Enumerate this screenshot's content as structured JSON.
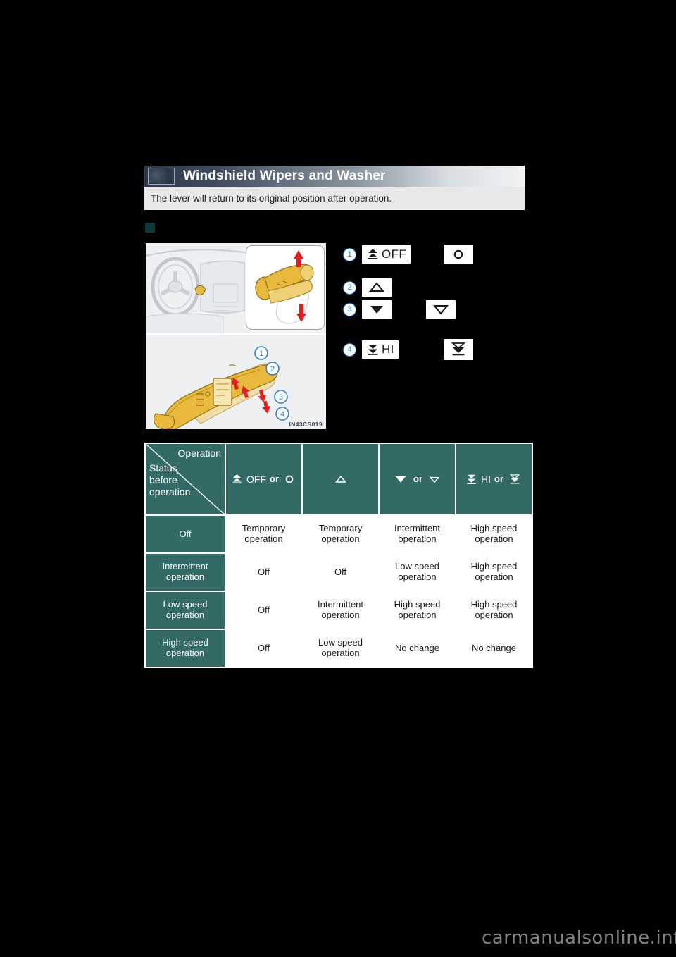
{
  "banner": {
    "title": "Windshield Wipers and Washer",
    "thumb_icon": "steering-wheel-thumbnail-icon"
  },
  "subbar": {
    "note": "The lever will return to its original position after operation."
  },
  "illustration": {
    "code": "IN43CS019",
    "callouts": [
      "1",
      "2",
      "3",
      "4"
    ]
  },
  "legend": {
    "items": [
      {
        "number": "1",
        "icon": "wiper-off-icon",
        "label": "OFF",
        "alt_icon": "circle-off-icon",
        "alt_label": ""
      },
      {
        "number": "2",
        "icon": "triangle-up-outline-icon",
        "label": "",
        "alt_icon": "",
        "alt_label": ""
      },
      {
        "number": "3",
        "icon": "triangle-down-filled-icon",
        "label": "",
        "alt_icon": "triangle-down-outline-icon",
        "alt_label": ""
      },
      {
        "number": "4",
        "icon": "wiper-hi-icon",
        "label": "HI",
        "alt_icon": "double-chevron-down-icon",
        "alt_label": ""
      }
    ]
  },
  "table": {
    "corner": {
      "operation_label": "Operation",
      "status_label": "Status\nbefore\noperation",
      "status_line1": "Status",
      "status_line2": "before",
      "status_line3": "operation"
    },
    "or_label": "or",
    "columns": [
      {
        "icon": "wiper-off-icon",
        "label": "OFF",
        "alt_icon": "circle-off-icon",
        "has_or": true
      },
      {
        "icon": "triangle-up-outline-icon",
        "label": "",
        "alt_icon": "",
        "has_or": false
      },
      {
        "icon": "triangle-down-filled-icon",
        "label": "",
        "alt_icon": "triangle-down-outline-icon",
        "has_or": true
      },
      {
        "icon": "wiper-hi-icon",
        "label": "HI",
        "alt_icon": "double-chevron-down-icon",
        "has_or": true
      }
    ],
    "rows": [
      {
        "header": "Off",
        "header_line1": "Off",
        "header_line2": "",
        "cells": [
          "Temporary\noperation",
          "Temporary\noperation",
          "Intermittent\noperation",
          "High speed\noperation"
        ],
        "cell_lines": [
          [
            "Temporary",
            "operation"
          ],
          [
            "Temporary",
            "operation"
          ],
          [
            "Intermittent",
            "operation"
          ],
          [
            "High speed",
            "operation"
          ]
        ]
      },
      {
        "header": "Intermittent operation",
        "header_line1": "Intermittent",
        "header_line2": "operation",
        "cells": [
          "Off",
          "Off",
          "Low speed\noperation",
          "High speed\noperation"
        ],
        "cell_lines": [
          [
            "Off",
            ""
          ],
          [
            "Off",
            ""
          ],
          [
            "Low speed",
            "operation"
          ],
          [
            "High speed",
            "operation"
          ]
        ]
      },
      {
        "header": "Low speed operation",
        "header_line1": "Low speed",
        "header_line2": "operation",
        "cells": [
          "Off",
          "Intermittent\noperation",
          "High speed\noperation",
          "High speed\noperation"
        ],
        "cell_lines": [
          [
            "Off",
            ""
          ],
          [
            "Intermittent",
            "operation"
          ],
          [
            "High speed",
            "operation"
          ],
          [
            "High speed",
            "operation"
          ]
        ]
      },
      {
        "header": "High speed operation",
        "header_line1": "High speed",
        "header_line2": "operation",
        "cells": [
          "Off",
          "Low speed\noperation",
          "No change",
          "No change"
        ],
        "cell_lines": [
          [
            "Off",
            ""
          ],
          [
            "Low speed",
            "operation"
          ],
          [
            "No change",
            ""
          ],
          [
            "No change",
            ""
          ]
        ]
      }
    ]
  },
  "watermark": "carmanualsonline.info",
  "colors": {
    "table_teal": "#336a66",
    "bullet_teal": "#0d3a3e",
    "callout_blue": "#1f7fd4",
    "arrow_red": "#e02020",
    "lever_yellow": "#e8b93c"
  }
}
